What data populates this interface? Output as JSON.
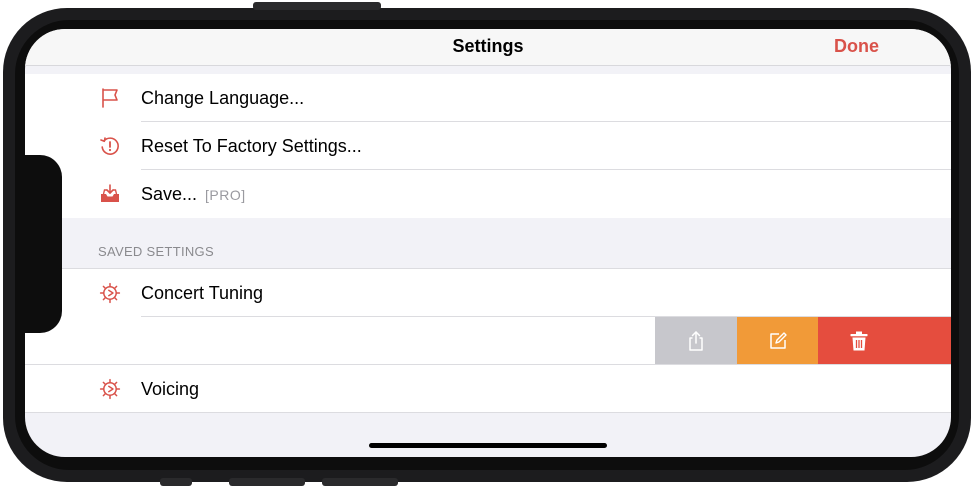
{
  "navbar": {
    "title": "Settings",
    "done_label": "Done"
  },
  "menu": {
    "items": [
      {
        "label": "Change Language...",
        "icon": "flag-icon"
      },
      {
        "label": "Reset To Factory Settings...",
        "icon": "reset-clock-icon"
      },
      {
        "label": "Save...",
        "icon": "tray-download-icon",
        "badge": "[PRO]"
      }
    ]
  },
  "saved_settings": {
    "header": "SAVED SETTINGS",
    "items": [
      {
        "label": "Concert Tuning",
        "icon": "setting-gear-icon"
      },
      {
        "label": "",
        "icon": "",
        "swiped": true
      },
      {
        "label": "Voicing",
        "icon": "setting-gear-icon"
      }
    ],
    "swipe_actions": [
      {
        "name": "share",
        "icon": "share-icon",
        "color": "#c7c7cc"
      },
      {
        "name": "edit",
        "icon": "edit-icon",
        "color": "#f19a38"
      },
      {
        "name": "delete",
        "icon": "trash-icon",
        "color": "#e54d3e"
      }
    ]
  },
  "colors": {
    "accent": "#d9524a",
    "background": "#f2f2f7"
  }
}
